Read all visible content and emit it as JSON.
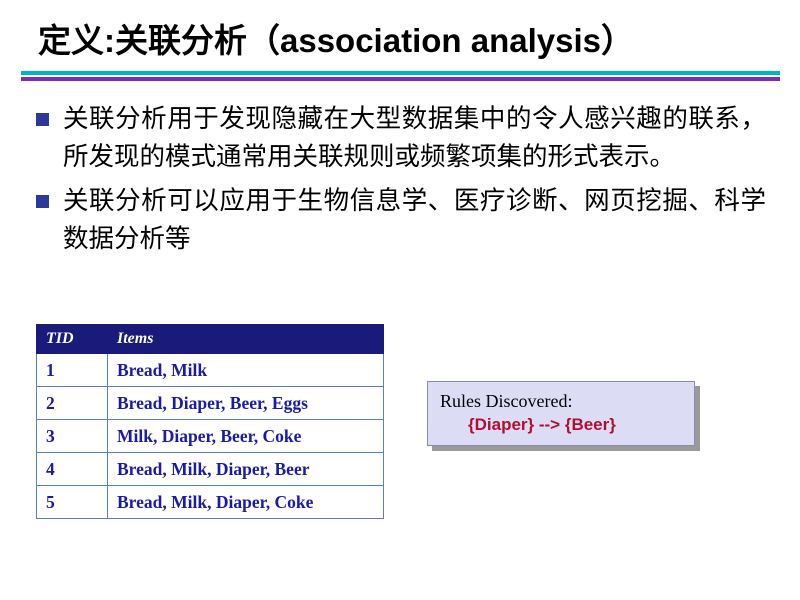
{
  "slide": {
    "title": "定义:关联分析（association analysis）",
    "bullets": [
      "关联分析用于发现隐藏在大型数据集中的令人感兴趣的联系，所发现的模式通常用关联规则或频繁项集的形式表示。",
      "关联分析可以应用于生物信息学、医疗诊断、网页挖掘、科学数据分析等"
    ],
    "table": {
      "headers": [
        "TID",
        "Items"
      ],
      "rows": [
        [
          "1",
          "Bread, Milk"
        ],
        [
          "2",
          "Bread, Diaper, Beer, Eggs"
        ],
        [
          "3",
          "Milk, Diaper, Beer, Coke"
        ],
        [
          "4",
          "Bread, Milk, Diaper, Beer"
        ],
        [
          "5",
          "Bread, Milk, Diaper, Coke"
        ]
      ]
    },
    "callout": {
      "line1": "Rules Discovered:",
      "line2": "{Diaper} --> {Beer}"
    },
    "colors": {
      "rule_cyan": "#00b6c4",
      "rule_purple": "#7b2bbd",
      "table_header_bg": "#1a1a7a",
      "table_text": "#1a1aa8",
      "callout_bg": "#dcdcf5",
      "callout_accent": "#b01030",
      "bullet_marker": "#2b3a99"
    }
  }
}
